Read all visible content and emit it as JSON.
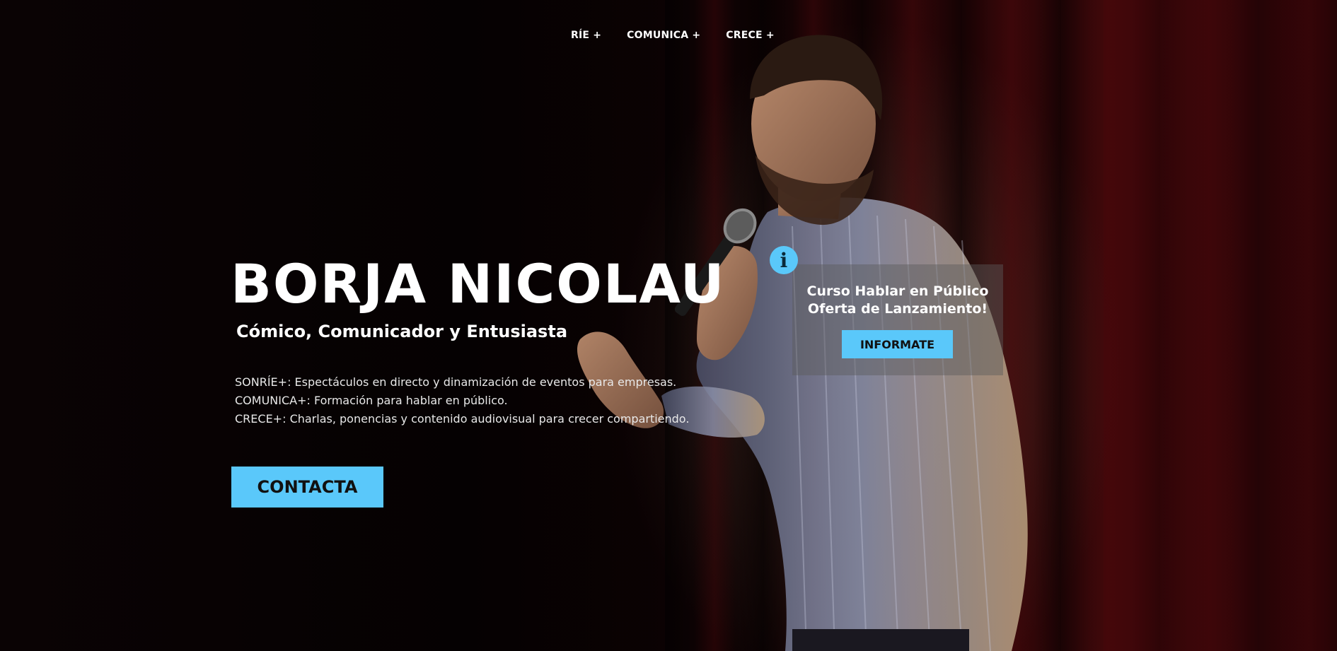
{
  "nav": {
    "items": [
      {
        "label": "RÍE +"
      },
      {
        "label": "COMUNICA +"
      },
      {
        "label": "CRECE +"
      }
    ]
  },
  "hero": {
    "title": "BORJA NICOLAU",
    "subtitle": "Cómico, Comunicador y Entusiasta",
    "services": [
      "SONRÍE+: Espectáculos en directo y dinamización de eventos para empresas.",
      "COMUNICA+: Formación para hablar en público.",
      "CRECE+: Charlas, ponencias y contenido audiovisual para crecer compartiendo."
    ],
    "contact_label": "CONTACTA"
  },
  "promo": {
    "icon": "info-icon",
    "icon_glyph": "i",
    "line1": "Curso Hablar en Público",
    "line2": "Oferta de Lanzamiento!",
    "button_label": "INFORMATE"
  },
  "colors": {
    "accent": "#5ac8fa",
    "text": "#ffffff",
    "background": "#000000"
  }
}
